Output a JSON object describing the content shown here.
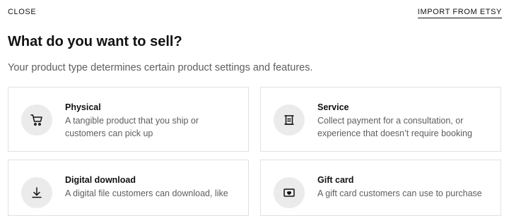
{
  "header": {
    "close_label": "CLOSE",
    "import_label": "IMPORT FROM ETSY"
  },
  "main": {
    "title": "What do you want to sell?",
    "subtitle": "Your product type determines certain product settings and features."
  },
  "product_types": [
    {
      "icon": "cart-icon",
      "title": "Physical",
      "description": "A tangible product that you ship or customers can pick up"
    },
    {
      "icon": "service-icon",
      "title": "Service",
      "description": "Collect payment for a consultation, or experience that doesn’t require booking"
    },
    {
      "icon": "download-icon",
      "title": "Digital download",
      "description": "A digital file customers can download, like"
    },
    {
      "icon": "gift-card-icon",
      "title": "Gift card",
      "description": "A gift card customers can use to purchase"
    }
  ]
}
